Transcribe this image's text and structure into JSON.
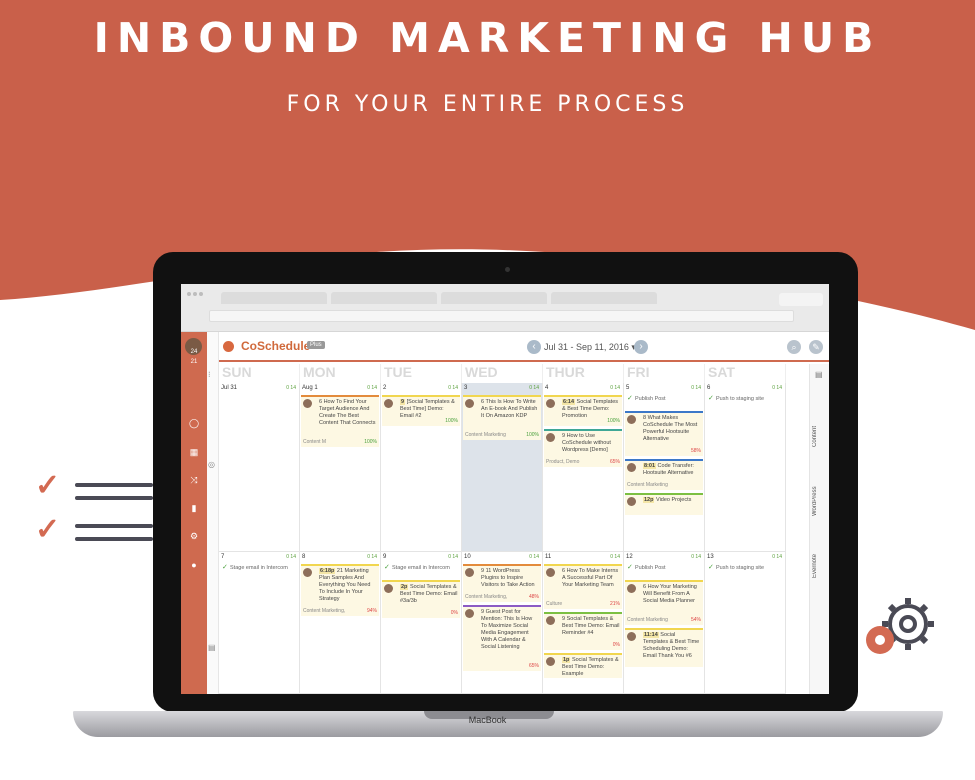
{
  "hero": {
    "title": "INBOUND MARKETING HUB",
    "subtitle": "FOR YOUR ENTIRE PROCESS"
  },
  "laptop_brand": "MacBook",
  "app": {
    "name": "CoSchedule",
    "plan_badge": "Plus",
    "date_range": "Jul 31 - Sep 11, 2016 ▾",
    "avatar_badge": "24",
    "sidebar_count": "21",
    "colors": {
      "brand": "#cf6a4f",
      "accent": "#d8683f",
      "today": "#dde3ea"
    }
  },
  "days": [
    "SUN",
    "MON",
    "TUE",
    "WED",
    "THUR",
    "FRI",
    "SAT"
  ],
  "week1": [
    {
      "date": "Jul 31",
      "counts": "0  14",
      "cards": []
    },
    {
      "date": "Aug 1",
      "counts": "0  14",
      "cards": [
        {
          "kind": "card",
          "color": "orange",
          "text": "6 How To Find Your Target Audience And Create The Best Content That Connects",
          "tag": "Content M",
          "pct": "100%",
          "ok": true
        }
      ]
    },
    {
      "date": "2",
      "counts": "0  14",
      "cards": [
        {
          "kind": "card",
          "color": "yellow",
          "time": "9",
          "text": "[Social Templates & Best Time] Demo: Email #2",
          "pct": "100%",
          "ok": true
        }
      ]
    },
    {
      "date": "3",
      "counts": "0  14",
      "today": true,
      "cards": [
        {
          "kind": "card",
          "color": "yellow",
          "text": "6 This Is How To Write An E-book And Publish It On Amazon KDP",
          "tag": "Content Marketing",
          "pct": "100%",
          "ok": true
        }
      ]
    },
    {
      "date": "4",
      "counts": "0  14",
      "cards": [
        {
          "kind": "card",
          "color": "yellow",
          "time": "6:14",
          "text": "Social Templates & Best Time Demo: Promotion",
          "pct": "100%",
          "ok": true
        },
        {
          "kind": "card",
          "color": "teal",
          "text": "9 How to Use CoSchedule without Wordpress [Demo]",
          "tag": "Product, Demo",
          "pct": "65%",
          "ok": false
        }
      ]
    },
    {
      "date": "5",
      "counts": "0  14",
      "cards": [
        {
          "kind": "simple",
          "text": "Publish Post"
        },
        {
          "kind": "card",
          "color": "blue",
          "text": "8 What Makes CoSchedule The Most Powerful Hootsuite Alternative",
          "pct": "58%",
          "ok": false
        },
        {
          "kind": "card",
          "color": "blue",
          "time": "8:01",
          "text": "Code Transfer: Hootsuite Alternative",
          "tag": "Content Marketing",
          "pct": "",
          "ok": false
        },
        {
          "kind": "card",
          "color": "green",
          "time": "12p",
          "text": "Video Projects",
          "pct": "",
          "ok": false
        }
      ]
    },
    {
      "date": "6",
      "counts": "0  14",
      "cards": [
        {
          "kind": "simple",
          "text": "Push to staging site"
        }
      ]
    }
  ],
  "week2": [
    {
      "date": "7",
      "counts": "0  14",
      "cards": [
        {
          "kind": "simple",
          "text": "Stage email in Intercom"
        }
      ]
    },
    {
      "date": "8",
      "counts": "0  14",
      "cards": [
        {
          "kind": "card",
          "color": "yellow",
          "time": "6:18p",
          "text": "21 Marketing Plan Samples And Everything You Need To Include In Your Strategy",
          "tag": "Content Marketing,",
          "pct": "94%",
          "ok": false
        }
      ]
    },
    {
      "date": "9",
      "counts": "0  14",
      "cards": [
        {
          "kind": "simple",
          "text": "Stage email in Intercom"
        },
        {
          "kind": "card",
          "color": "yellow",
          "time": "2p",
          "text": "Social Templates & Best Time Demo: Email #3a/3b",
          "pct": "0%",
          "ok": false
        }
      ]
    },
    {
      "date": "10",
      "counts": "0  14",
      "cards": [
        {
          "kind": "card",
          "color": "orange",
          "text": "9 11 WordPress Plugins to Inspire Visitors to Take Action",
          "tag": "Content Marketing,",
          "pct": "48%",
          "ok": false
        },
        {
          "kind": "card",
          "color": "purple",
          "text": "9 Guest Post for Mention: This Is How To Maximize Social Media Engagement With A Calendar & Social Listening",
          "pct": "65%",
          "ok": false
        }
      ]
    },
    {
      "date": "11",
      "counts": "0  14",
      "cards": [
        {
          "kind": "card",
          "color": "yellow",
          "text": "6 How To Make Interns A Successful Part Of Your Marketing Team",
          "tag": "Culture",
          "pct": "21%",
          "ok": false
        },
        {
          "kind": "card",
          "color": "green",
          "text": "9 Social Templates & Best Time Demo: Email Reminder #4",
          "pct": "0%",
          "ok": false
        },
        {
          "kind": "card",
          "color": "yellow",
          "time": "1p",
          "text": "Social Templates & Best Time Demo: Example",
          "pct": "",
          "ok": false
        }
      ]
    },
    {
      "date": "12",
      "counts": "0  14",
      "cards": [
        {
          "kind": "simple",
          "text": "Publish Post"
        },
        {
          "kind": "card",
          "color": "yellow",
          "text": "6 How Your Marketing Will Benefit From A Social Media Planner",
          "tag": "Content Marketing",
          "pct": "54%",
          "ok": false
        },
        {
          "kind": "card",
          "color": "yellow",
          "time": "11:14",
          "text": "Social Templates & Best Time Scheduling Demo: Email Thank You #6",
          "pct": "",
          "ok": false
        }
      ]
    },
    {
      "date": "13",
      "counts": "0  14",
      "cards": [
        {
          "kind": "simple",
          "text": "Push to staging site"
        }
      ]
    }
  ],
  "rail": [
    "Content",
    "WordPress",
    "Evernote"
  ]
}
